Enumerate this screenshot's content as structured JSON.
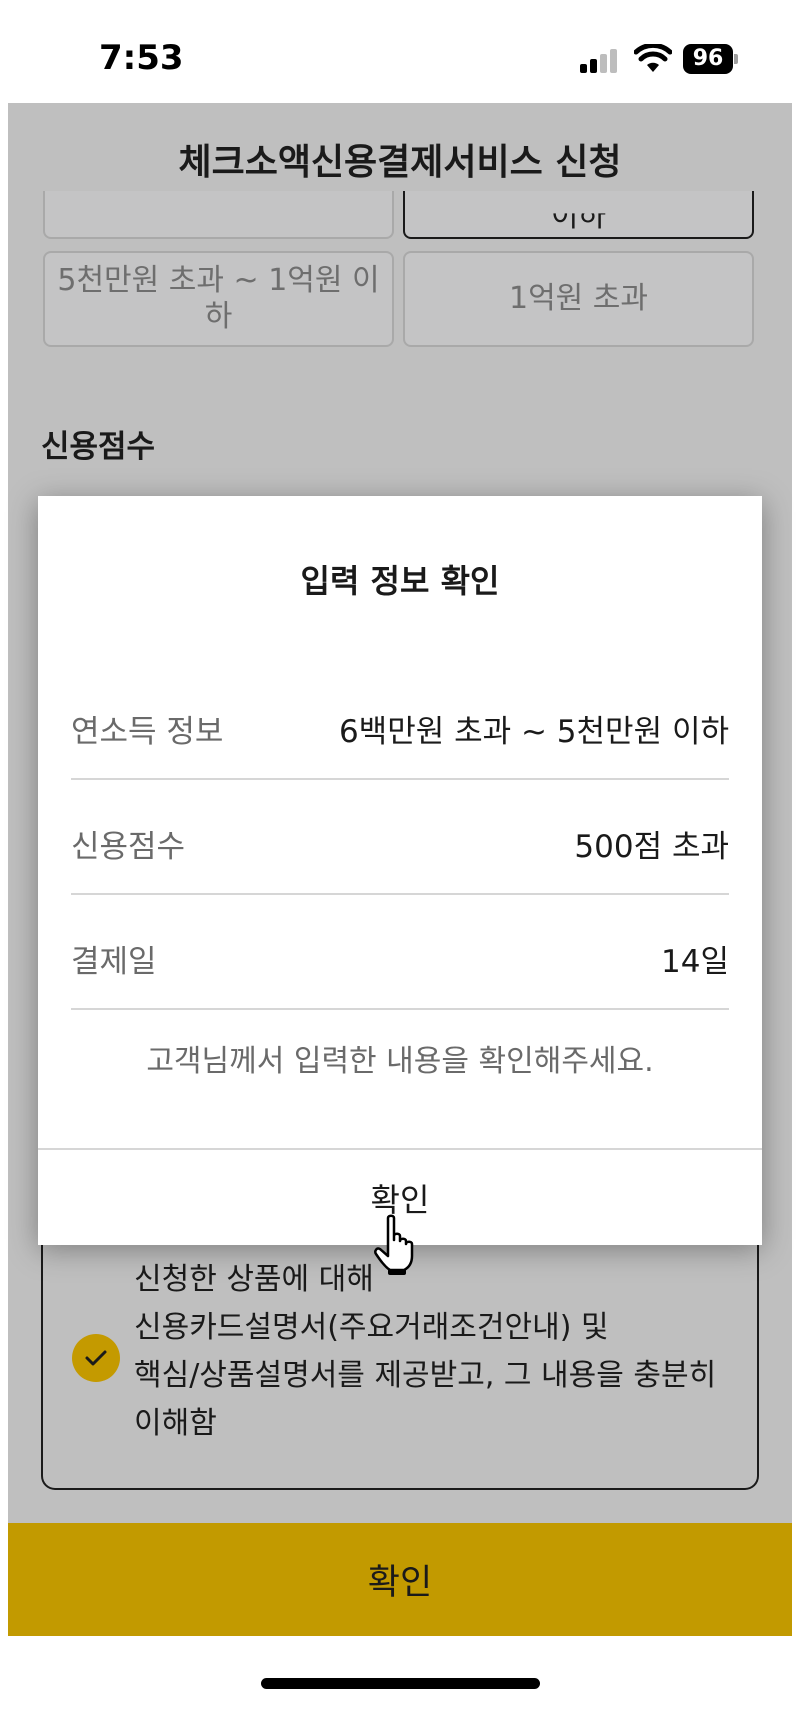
{
  "status_bar": {
    "time": "7:53",
    "battery": "96"
  },
  "header": {
    "title": "체크소액신용결제서비스 신청"
  },
  "income_options": {
    "partial_left": "",
    "partial_right": "이하",
    "items": [
      {
        "label_line1": "5천만원 초과 ~ 1억원 이",
        "label_line2": "하"
      },
      {
        "label": "1억원 초과"
      }
    ]
  },
  "credit_section": {
    "label": "신용점수"
  },
  "agreement": {
    "lines": [
      "신청한 상품에 대해",
      "신용카드설명서(주요거래조건안내) 및",
      "핵심/상품설명서를 제공받고, 그 내용을 충분히",
      "이해함"
    ],
    "checked": true
  },
  "bottom_button": {
    "label": "확인"
  },
  "modal": {
    "title": "입력 정보 확인",
    "rows": [
      {
        "label": "연소득 정보",
        "value": "6백만원 초과 ~ 5천만원 이하"
      },
      {
        "label": "신용점수",
        "value": "500점 초과"
      },
      {
        "label": "결제일",
        "value": "14일"
      }
    ],
    "note": "고객님께서 입력한 내용을 확인해주세요.",
    "confirm_label": "확인"
  },
  "colors": {
    "accent": "#c29a00",
    "dim_overlay": "#bfbfbf"
  },
  "icons": {
    "signal": "cellular-signal-icon",
    "wifi": "wifi-icon",
    "battery": "battery-icon",
    "check": "checkmark-icon",
    "cursor": "hand-pointer-icon"
  }
}
